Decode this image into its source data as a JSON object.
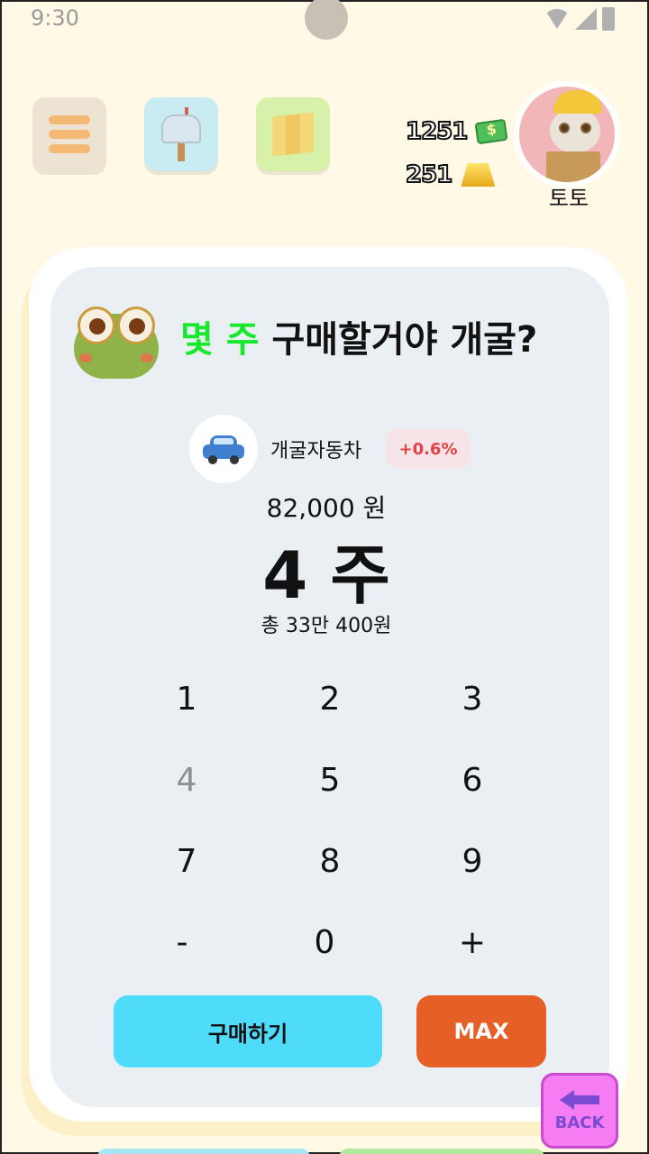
{
  "status_bar": {
    "time": "9:30"
  },
  "top_bar": {
    "coins": "1251",
    "gold": "251",
    "username": "토토"
  },
  "dialog": {
    "title_accent": "몇 주",
    "title_rest": " 구매할거야 개굴?",
    "stock": {
      "name": "개굴자동차",
      "change": "+0.6%",
      "icon": "car-icon"
    },
    "price": "82,000 원",
    "shares": "4 주",
    "total": "총 33만 400원"
  },
  "keypad": {
    "keys": [
      "1",
      "2",
      "3",
      "4",
      "5",
      "6",
      "7",
      "8",
      "9",
      "-",
      "0",
      "+"
    ]
  },
  "buttons": {
    "buy": "구매하기",
    "max": "MAX",
    "back": "BACK"
  },
  "colors": {
    "background": "#fff9e6",
    "accent_green": "#17e82c",
    "buy_button": "#4fdcfb",
    "max_button": "#e65f26",
    "change_red": "#e04444",
    "back_button": "#f57cf2"
  }
}
